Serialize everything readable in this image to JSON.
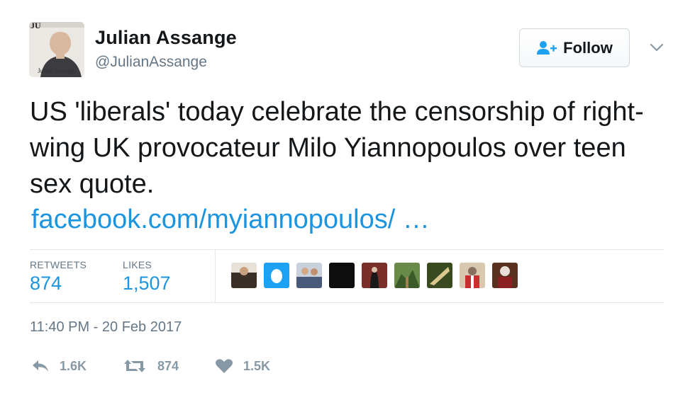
{
  "header": {
    "name": "Julian Assange",
    "handle": "@JulianAssange",
    "avatar_caption": "Julian Assange",
    "follow_label": "Follow"
  },
  "tweet": {
    "text": "US 'liberals' today celebrate the censorship of right-wing UK provocateur Milo Yiannopoulos over teen sex quote.",
    "link": "facebook.com/myiannopoulos/ …"
  },
  "stats": {
    "retweets_label": "RETWEETS",
    "retweets_value": "874",
    "likes_label": "LIKES",
    "likes_value": "1,507"
  },
  "liker_avatars": [
    {
      "icon": "liker-avatar-1",
      "color": "#5a4a3a"
    },
    {
      "icon": "liker-avatar-2",
      "color": "#1da1f2"
    },
    {
      "icon": "liker-avatar-3",
      "color": "#7a8aa0"
    },
    {
      "icon": "liker-avatar-4",
      "color": "#111111"
    },
    {
      "icon": "liker-avatar-5",
      "color": "#6b2b25"
    },
    {
      "icon": "liker-avatar-6",
      "color": "#4f6b3a"
    },
    {
      "icon": "liker-avatar-7",
      "color": "#4a6a2a"
    },
    {
      "icon": "liker-avatar-8",
      "color": "#a89070"
    },
    {
      "icon": "liker-avatar-9",
      "color": "#8a4a2a"
    }
  ],
  "timestamp": "11:40 PM - 20 Feb 2017",
  "actions": {
    "reply_count": "1.6K",
    "retweet_count": "874",
    "like_count": "1.5K"
  },
  "colors": {
    "link": "#1b95e0",
    "muted": "#657786",
    "icon": "#8899a6",
    "divider": "#e1e8ed"
  }
}
